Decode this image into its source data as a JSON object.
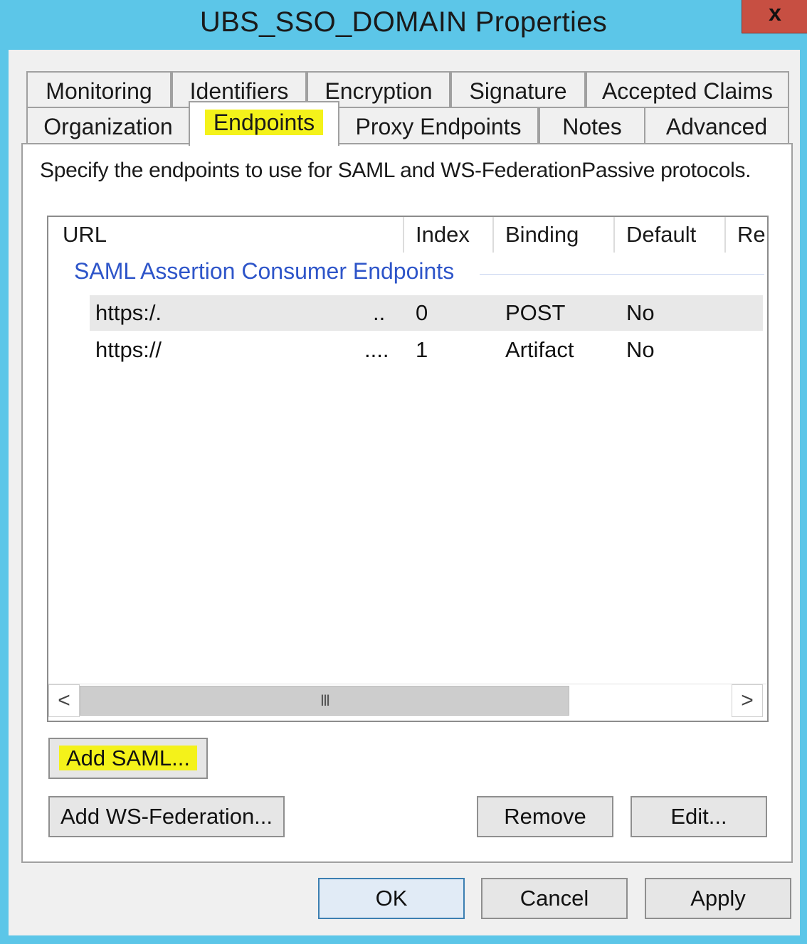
{
  "window": {
    "title": "UBS_SSO_DOMAIN Properties",
    "close_label": "x"
  },
  "tabs_row1": [
    "Monitoring",
    "Identifiers",
    "Encryption",
    "Signature",
    "Accepted Claims"
  ],
  "tabs_row2": [
    "Organization",
    "Endpoints",
    "Proxy Endpoints",
    "Notes",
    "Advanced"
  ],
  "active_tab": "Endpoints",
  "highlight_color": "#f4f21a",
  "panel": {
    "description": "Specify the endpoints to use for SAML and WS-FederationPassive protocols.",
    "columns": [
      "URL",
      "Index",
      "Binding",
      "Default",
      "Re"
    ],
    "group_label": "SAML Assertion Consumer Endpoints",
    "rows": [
      {
        "url": "https:/.",
        "ellipsis": "..",
        "index": "0",
        "binding": "POST",
        "default": "No"
      },
      {
        "url": "https://",
        "ellipsis": "....",
        "index": "1",
        "binding": "Artifact",
        "default": "No"
      }
    ],
    "scrollbar": {
      "left_arrow": "<",
      "right_arrow": ">",
      "grip": "III"
    }
  },
  "buttons": {
    "add_saml": "Add SAML...",
    "add_ws_federation": "Add WS-Federation...",
    "remove": "Remove",
    "edit": "Edit...",
    "ok": "OK",
    "cancel": "Cancel",
    "apply": "Apply"
  }
}
